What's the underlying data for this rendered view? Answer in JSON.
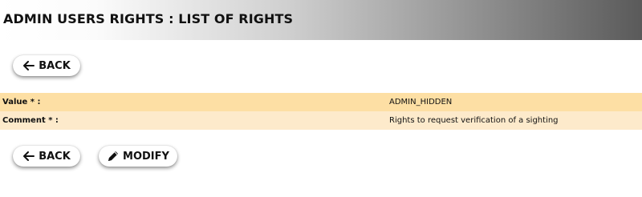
{
  "header": {
    "title": "ADMIN USERS RIGHTS : LIST OF RIGHTS"
  },
  "actions": {
    "back_label": "BACK",
    "modify_label": "MODIFY"
  },
  "icons": {
    "back": "arrow-left-icon",
    "modify": "pencil-icon"
  },
  "details": {
    "rows": [
      {
        "label": "Value * :",
        "value": "ADMIN_HIDDEN"
      },
      {
        "label": "Comment * :",
        "value": "Rights to request verification of a sighting"
      }
    ]
  },
  "colors": {
    "row_odd": "#fddfa4",
    "row_even": "#fdeacb",
    "header_gradient_end": "#5a5a5a"
  }
}
